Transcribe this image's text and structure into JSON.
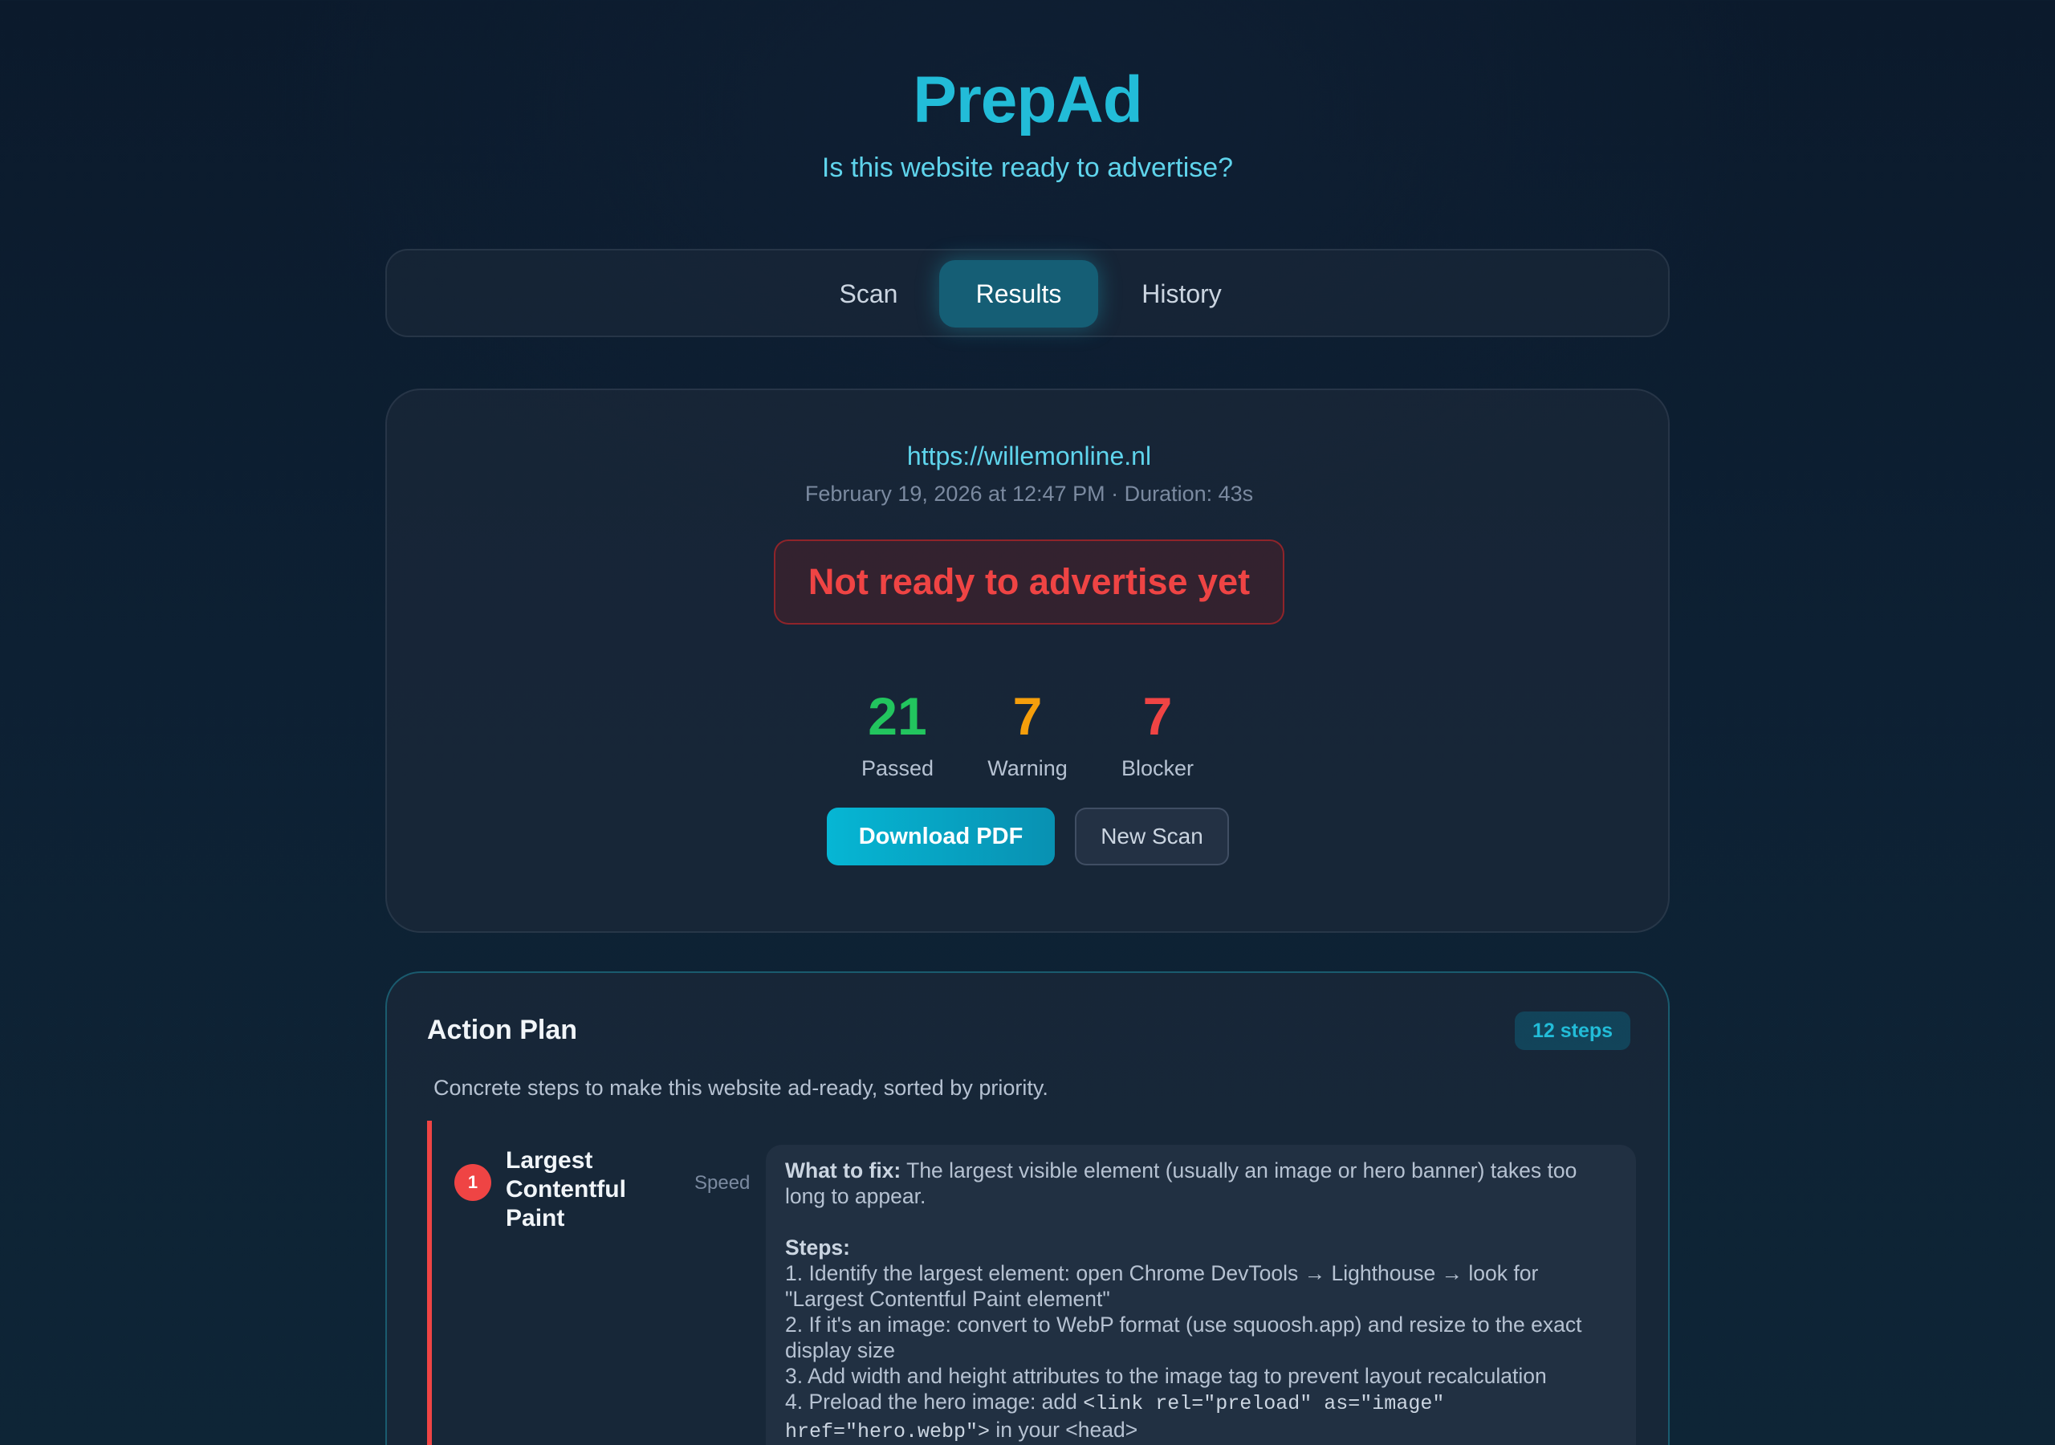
{
  "header": {
    "brand": "PrepAd",
    "tagline": "Is this website ready to advertise?"
  },
  "tabs": [
    {
      "label": "Scan",
      "active": false
    },
    {
      "label": "Results",
      "active": true
    },
    {
      "label": "History",
      "active": false
    }
  ],
  "summary": {
    "url": "https://willemonline.nl",
    "meta": "February 19, 2026 at 12:47 PM · Duration: 43s",
    "verdict": "Not ready to advertise yet",
    "stats": {
      "passed": {
        "value": "21",
        "label": "Passed",
        "color": "#22c55e"
      },
      "warning": {
        "value": "7",
        "label": "Warning",
        "color": "#f59e0b"
      },
      "blocker": {
        "value": "7",
        "label": "Blocker",
        "color": "#ef4444"
      }
    },
    "download_label": "Download PDF",
    "new_scan_label": "New Scan"
  },
  "action_plan": {
    "title": "Action Plan",
    "badge": "12 steps",
    "description": "Concrete steps to make this website ad-ready, sorted by priority.",
    "items": [
      {
        "number": "1",
        "name": "Largest Contentful Paint",
        "category": "Speed",
        "what_label": "What to fix:",
        "what_text": " The largest visible element (usually an image or hero banner) takes too long to appear.",
        "steps_label": "Steps:",
        "step1": "1. Identify the largest element: open Chrome DevTools → Lighthouse → look for \"Largest Contentful Paint element\"",
        "step2": "2. If it's an image: convert to WebP format (use squoosh.app) and resize to the exact display size",
        "step3": "3. Add width and height attributes to the image tag to prevent layout recalculation",
        "step4_pre": "4. Preload the hero image: add ",
        "step4_code": "<link rel=\"preload\" as=\"image\" href=\"hero.webp\">",
        "step4_post": " in your <head>"
      }
    ]
  },
  "colors": {
    "accent": "#22bcd8",
    "danger": "#ef4444",
    "success": "#22c55e",
    "warning": "#f59e0b"
  }
}
